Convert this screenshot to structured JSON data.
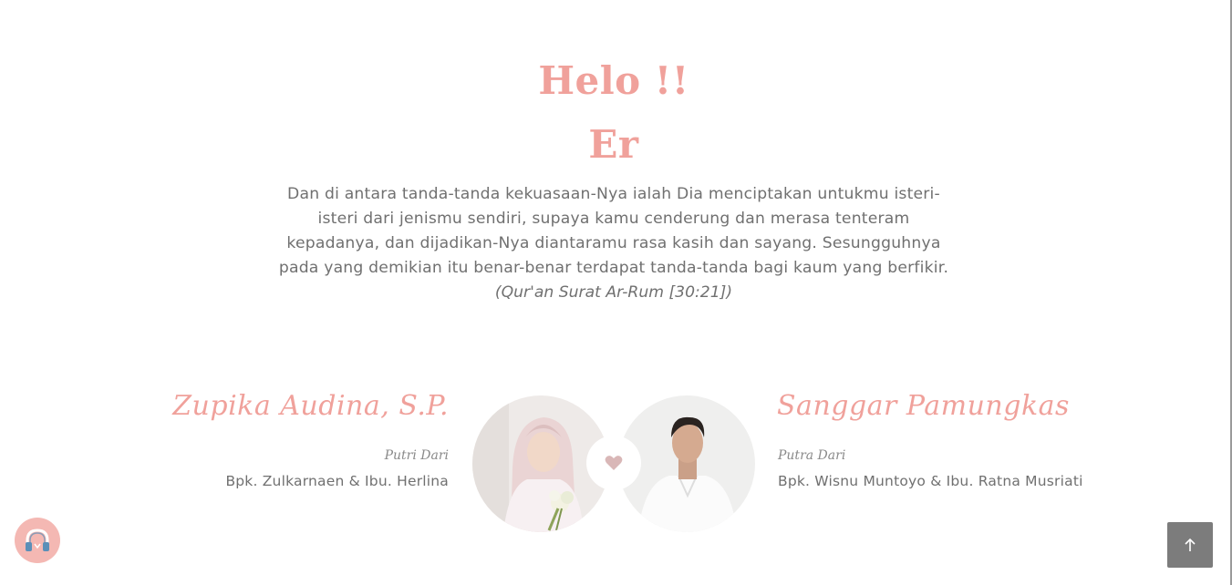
{
  "greeting": {
    "hello": "Helo !!",
    "guest_name": "Er"
  },
  "quote": {
    "text": "Dan di antara tanda-tanda kekuasaan-Nya ialah Dia menciptakan untukmu isteri-isteri dari jenismu sendiri, supaya kamu cenderung dan merasa tenteram kepadanya, dan dijadikan-Nya diantaramu rasa kasih dan sayang. Sesungguhnya pada yang demikian itu benar-benar terdapat tanda-tanda bagi kaum yang berfikir.",
    "source": "(Qur'an Surat Ar-Rum [30:21])"
  },
  "couple": {
    "bride": {
      "name": "Zupika Audina, S.P.",
      "parent_label": "Putri Dari",
      "parents": "Bpk. Zulkarnaen & Ibu. Herlina"
    },
    "groom": {
      "name": "Sanggar Pamungkas",
      "parent_label": "Putra Dari",
      "parents": "Bpk. Wisnu Muntoyo & Ibu. Ratna Musriati"
    }
  },
  "controls": {
    "music_icon": "headphones-icon",
    "back_to_top_icon": "arrow-up-icon"
  },
  "colors": {
    "accent": "#f0a19b",
    "text": "#707070",
    "music_button": "#f4b8b3",
    "top_button": "#7c7c7c"
  }
}
